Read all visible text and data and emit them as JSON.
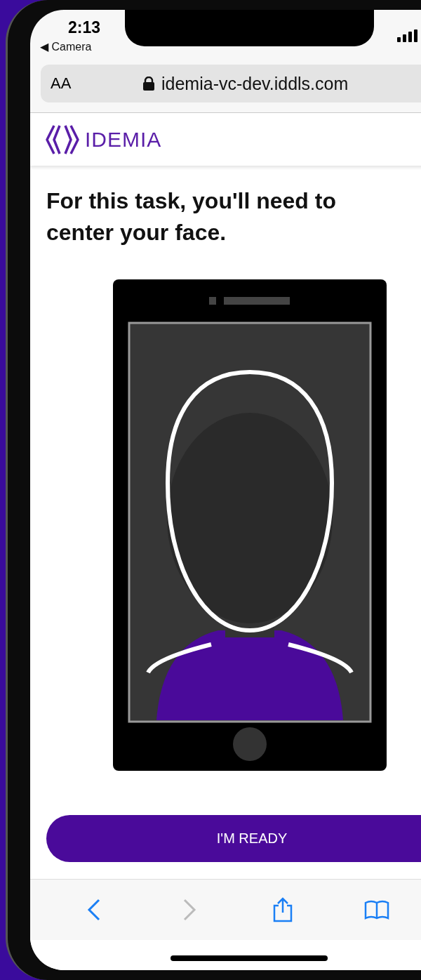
{
  "status_bar": {
    "time": "2:13",
    "back_app": "◀ Camera"
  },
  "address_bar": {
    "text_size": "AA",
    "url": "idemia-vc-dev.iddls.com"
  },
  "header": {
    "logo_text": "IDEMIA"
  },
  "heading": "For this task, you'll need to center your face.",
  "primary_button": "I'M READY",
  "toolbar": [
    {
      "kind": "back",
      "disabled": false
    },
    {
      "kind": "forward",
      "disabled": true
    },
    {
      "kind": "share",
      "disabled": false
    },
    {
      "kind": "bookmarks",
      "disabled": false
    }
  ]
}
